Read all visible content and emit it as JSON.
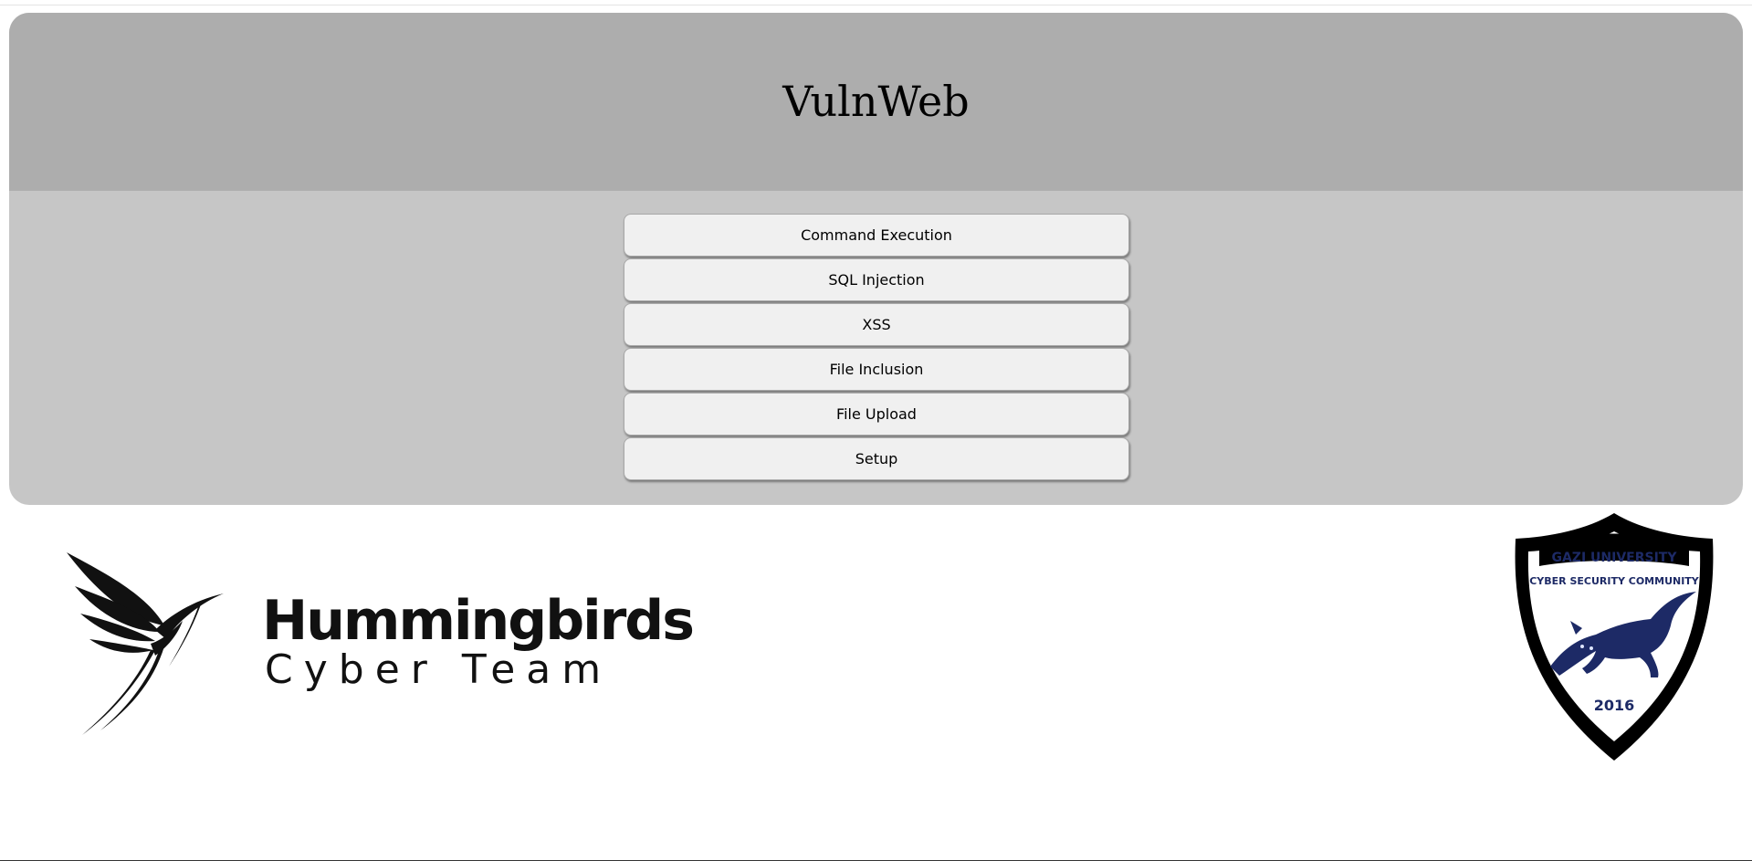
{
  "site": {
    "title": "VulnWeb"
  },
  "menu": {
    "items": [
      {
        "label": "Command Execution"
      },
      {
        "label": "SQL Injection"
      },
      {
        "label": "XSS"
      },
      {
        "label": "File Inclusion"
      },
      {
        "label": "File Upload"
      },
      {
        "label": "Setup"
      }
    ]
  },
  "logos": {
    "hummingbirds": {
      "title": "Hummingbirds",
      "subtitle": "Cyber Team",
      "icon": "hummingbird-icon"
    },
    "gazi": {
      "line1": "GAZI UNIVERSITY",
      "line2": "CYBER SECURITY COMMUNITY",
      "year": "2016",
      "icon": "wolf-shield-icon"
    }
  },
  "colors": {
    "header_bg": "#adadad",
    "panel_bg": "#c6c6c6",
    "button_bg": "#f0f0f0",
    "crest_navy": "#1d2a66"
  }
}
